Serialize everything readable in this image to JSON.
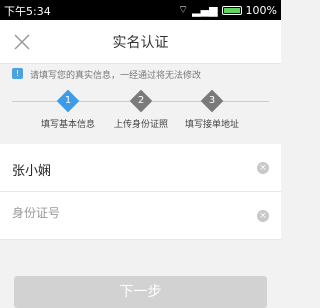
{
  "status": {
    "time": "下午5:34",
    "battery": "100%"
  },
  "header": {
    "title": "实名认证"
  },
  "notice": {
    "text": "请填写您的真实信息，一经通过将无法修改"
  },
  "steps": [
    {
      "num": "1",
      "label": "填写基本信息"
    },
    {
      "num": "2",
      "label": "上传身份证照"
    },
    {
      "num": "3",
      "label": "填写接单地址"
    }
  ],
  "form": {
    "name_value": "张小娴",
    "id_placeholder": "身份证号"
  },
  "next_label": "下一步",
  "colors": {
    "active_step": "#3e9be8",
    "inactive_step": "#7a7a7a"
  }
}
